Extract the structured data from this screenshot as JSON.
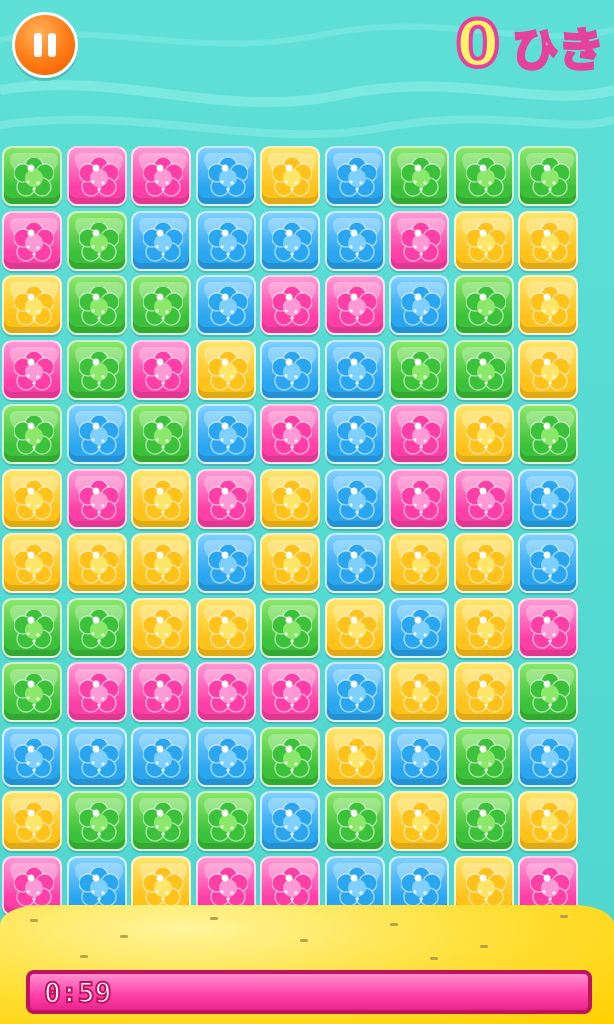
{
  "hud": {
    "count": "0",
    "count_unit": "ひき",
    "timer": "0:59",
    "timer_fill": 1.0
  },
  "colors": {
    "green": "#3cc13a",
    "pink": "#ff3fa6",
    "blue": "#2aa6f0",
    "yellow": "#ffc21a",
    "pause_orange": "#ff7a14",
    "timer_pink": "#ff3fa6"
  },
  "board": {
    "columns": 9,
    "rows": [
      [
        "green",
        "pink",
        "pink",
        "blue",
        "yellow",
        "blue",
        "green",
        "green",
        "green"
      ],
      [
        "pink",
        "green",
        "blue",
        "blue",
        "blue",
        "blue",
        "pink",
        "yellow",
        "yellow"
      ],
      [
        "yellow",
        "green",
        "green",
        "blue",
        "pink",
        "pink",
        "blue",
        "green",
        "yellow"
      ],
      [
        "pink",
        "green",
        "pink",
        "yellow",
        "blue",
        "blue",
        "green",
        "green",
        "yellow"
      ],
      [
        "green",
        "blue",
        "green",
        "blue",
        "pink",
        "blue",
        "pink",
        "yellow",
        "green"
      ],
      [
        "yellow",
        "pink",
        "yellow",
        "pink",
        "yellow",
        "blue",
        "pink",
        "pink",
        "blue"
      ],
      [
        "yellow",
        "yellow",
        "yellow",
        "blue",
        "yellow",
        "blue",
        "yellow",
        "yellow",
        "blue"
      ],
      [
        "green",
        "green",
        "yellow",
        "yellow",
        "green",
        "yellow",
        "blue",
        "yellow",
        "pink"
      ],
      [
        "green",
        "pink",
        "pink",
        "pink",
        "pink",
        "blue",
        "yellow",
        "yellow",
        "green"
      ],
      [
        "blue",
        "blue",
        "blue",
        "blue",
        "green",
        "yellow",
        "blue",
        "green",
        "blue"
      ],
      [
        "yellow",
        "green",
        "green",
        "green",
        "blue",
        "green",
        "yellow",
        "green",
        "yellow"
      ],
      [
        "pink",
        "blue",
        "yellow",
        "pink",
        "pink",
        "blue",
        "blue",
        "yellow",
        "pink"
      ]
    ]
  }
}
